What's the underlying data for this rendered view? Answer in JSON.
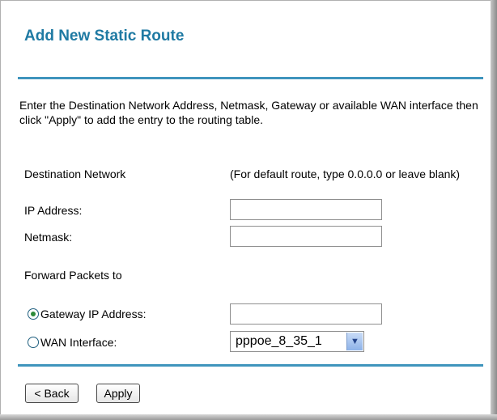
{
  "title": "Add New Static Route",
  "intro": "Enter the Destination Network Address, Netmask, Gateway or available WAN interface then click \"Apply\" to add the entry to the routing table.",
  "destination": {
    "label": "Destination Network",
    "note": "(For default route, type 0.0.0.0 or leave blank)",
    "ip_label": "IP Address:",
    "ip_value": "",
    "netmask_label": "Netmask:",
    "netmask_value": ""
  },
  "forward": {
    "label": "Forward Packets to",
    "gateway_label": "Gateway IP Address:",
    "gateway_value": "",
    "gateway_selected": true,
    "wan_label": "WAN Interface:",
    "wan_selected": false,
    "wan_value": "pppoe_8_35_1"
  },
  "buttons": {
    "back": "< Back",
    "apply": "Apply"
  },
  "colors": {
    "title": "#1f7aa3",
    "rule": "#3f95bd"
  }
}
